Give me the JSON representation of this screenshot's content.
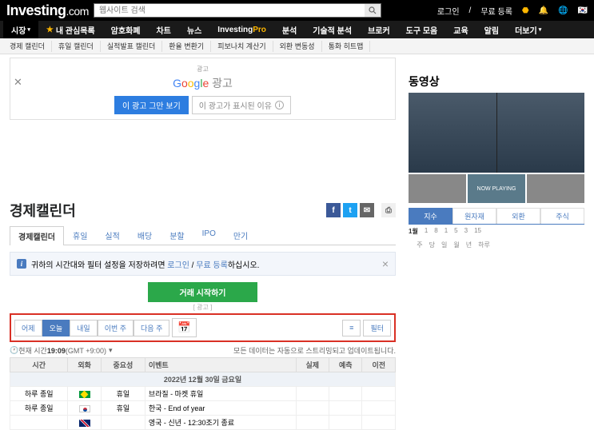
{
  "brand": {
    "name": "Investing",
    "suffix": ".com"
  },
  "search": {
    "placeholder": "웹사이트 검색"
  },
  "top_right": {
    "login": "로그인",
    "signup": "무료 등록"
  },
  "nav_main": [
    "시장",
    "내 관심목록",
    "암호화폐",
    "차트",
    "뉴스",
    "InvestingPro",
    "분석",
    "기술적 분석",
    "브로커",
    "도구 모음",
    "교육",
    "알림",
    "더보기"
  ],
  "nav_sub": [
    "경제 캘린더",
    "휴일 캘린더",
    "실적발표 캘린더",
    "환율 변환기",
    "피보나치 계산기",
    "외환 변동성",
    "통화 히트맵"
  ],
  "ad": {
    "label": "광고",
    "google": "Google",
    "google_suffix": "광고",
    "btn_stop": "이 광고 그만 보기",
    "btn_why": "이 광고가 표시된 이유"
  },
  "page_title": "경제캘린더",
  "tabs": [
    "경제캘린더",
    "휴일",
    "실적",
    "배당",
    "분할",
    "IPO",
    "만기"
  ],
  "notice": {
    "text_pre": "귀하의 시간대와 필터 설정을 저장하려면 ",
    "link1": "로그인",
    "sep": " / ",
    "link2": "무료 등록",
    "text_post": "하십시오."
  },
  "cta": {
    "label": "거래 시작하기",
    "sub": "[ 광고 ]"
  },
  "filters": [
    "어제",
    "오늘",
    "내일",
    "이번 주",
    "다음 주"
  ],
  "filter_right": "필터",
  "meta": {
    "left_pre": "현재 시간 ",
    "time": "19:09",
    "tz": " (GMT +9:00)",
    "right": "모든 데이터는 자동으로 스트리밍되고 업데이트됩니다."
  },
  "table": {
    "headers": [
      "시간",
      "외화",
      "중요성",
      "이벤트",
      "실제",
      "예측",
      "이전"
    ],
    "date_row": "2022년 12월 30일 금요일",
    "rows": [
      {
        "time": "하루 종일",
        "flag": "br",
        "imp": "휴일",
        "event": "브라질 - 마켓 휴일"
      },
      {
        "time": "하루 종일",
        "flag": "kr",
        "imp": "휴일",
        "event": "한국 - End of year"
      },
      {
        "time": "",
        "flag": "gb",
        "imp": "",
        "event": "영국 - 신년 - 12:30조기 종료"
      }
    ]
  },
  "side": {
    "title": "동영상",
    "now_playing": "NOW PLAYING",
    "tabs": [
      "지수",
      "원자재",
      "외환",
      "주식"
    ],
    "cal": {
      "month": "1월",
      "days": [
        "주",
        "당",
        "일",
        "월",
        "년",
        "하루"
      ],
      "nums": [
        "1",
        "8",
        "1",
        "5",
        "3",
        "15"
      ]
    }
  }
}
